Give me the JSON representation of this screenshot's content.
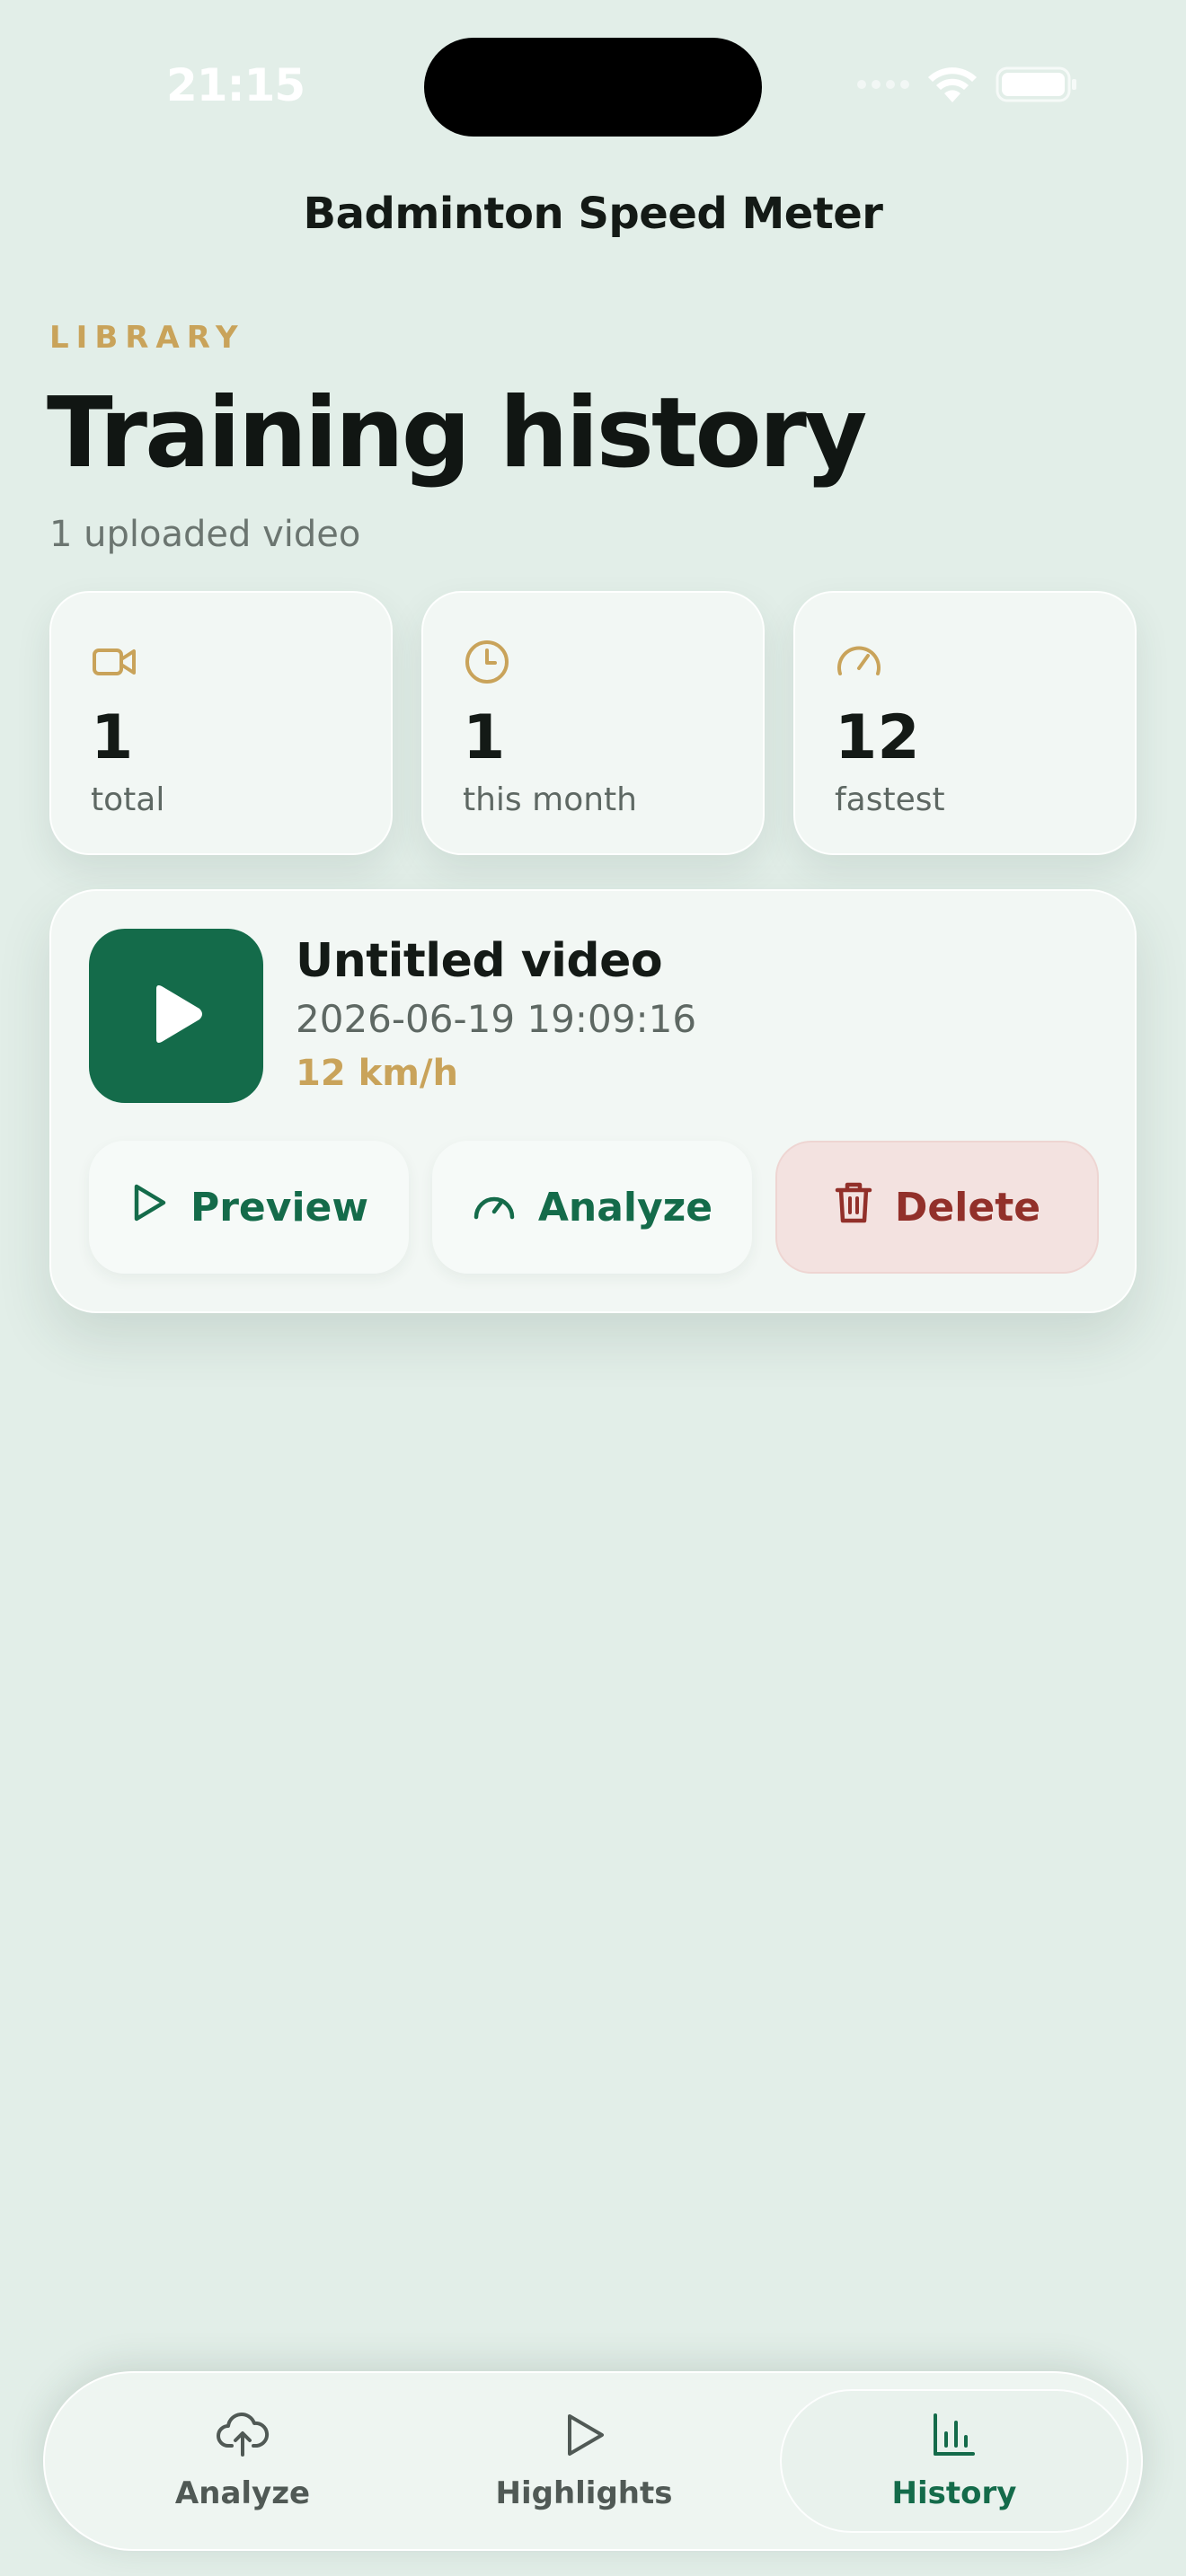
{
  "status_bar": {
    "time": "21:15"
  },
  "header": {
    "app_title": "Badminton Speed Meter"
  },
  "page": {
    "eyebrow": "LIBRARY",
    "heading": "Training history",
    "subtitle": "1 uploaded video"
  },
  "stats": [
    {
      "icon": "video-camera-icon",
      "value": "1",
      "label": "total"
    },
    {
      "icon": "clock-icon",
      "value": "1",
      "label": "this month"
    },
    {
      "icon": "speedometer-icon",
      "value": "12",
      "label": "fastest"
    }
  ],
  "videos": [
    {
      "title": "Untitled video",
      "date": "2026-06-19 19:09:16",
      "speed": "12 km/h",
      "actions": {
        "preview": "Preview",
        "analyze": "Analyze",
        "delete": "Delete"
      }
    }
  ],
  "tabbar": {
    "items": [
      {
        "label": "Analyze",
        "icon": "cloud-upload-icon"
      },
      {
        "label": "Highlights",
        "icon": "play-icon"
      },
      {
        "label": "History",
        "icon": "bar-chart-icon"
      }
    ],
    "active": "History"
  },
  "colors": {
    "background": "#e2eee8",
    "accent_green": "#146b4a",
    "accent_gold": "#c9a35a",
    "danger": "#92302a"
  }
}
